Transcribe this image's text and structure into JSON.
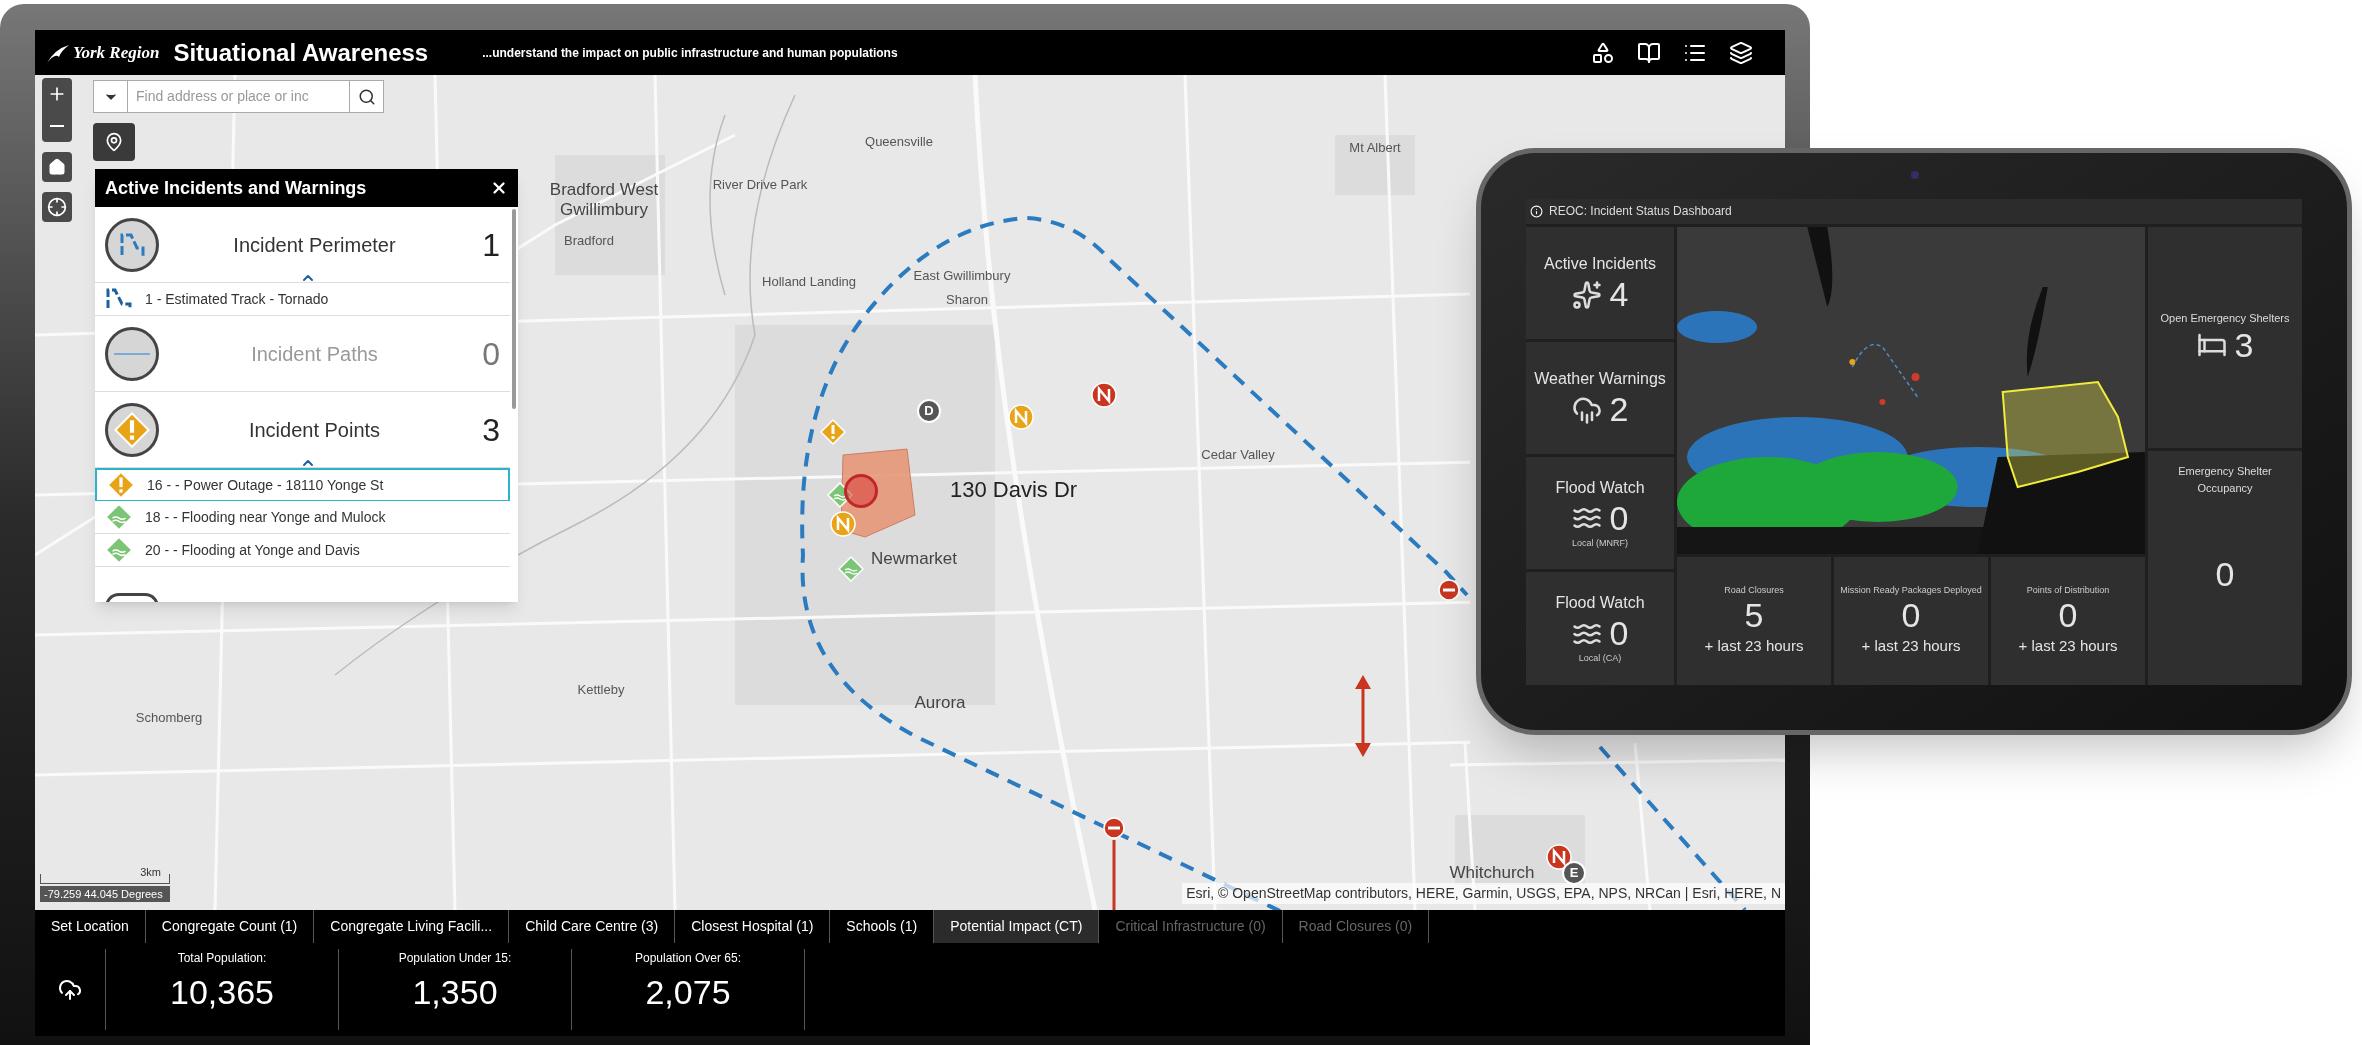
{
  "header": {
    "logo": "York Region",
    "title": "Situational Awareness",
    "tagline": "...understand the impact on public infrastructure and human populations"
  },
  "search": {
    "placeholder": "Find address or place or inc"
  },
  "incident_panel": {
    "title": "Active Incidents and Warnings",
    "groups": [
      {
        "kind": "perimeter",
        "label": "Incident Perimeter",
        "count": "1",
        "disabled": false,
        "items": [
          {
            "kind": "track",
            "label": "1 - Estimated Track - Tornado",
            "selected": false
          }
        ]
      },
      {
        "kind": "path",
        "label": "Incident Paths",
        "count": "0",
        "disabled": true
      },
      {
        "kind": "point",
        "label": "Incident Points",
        "count": "3",
        "disabled": false,
        "items": [
          {
            "kind": "warning",
            "label": "16 - - Power Outage - 18110 Yonge St",
            "selected": true
          },
          {
            "kind": "flood",
            "label": "18 - - Flooding near Yonge and Mulock",
            "selected": false
          },
          {
            "kind": "flood",
            "label": "20 - - Flooding at Yonge and Davis",
            "selected": false
          }
        ]
      }
    ]
  },
  "map_labels": [
    {
      "kind": "small",
      "text": "Queensville"
    },
    {
      "kind": "small",
      "text": "Mt Albert"
    },
    {
      "kind": "town",
      "text": "Bradford West Gwillimbury"
    },
    {
      "kind": "small",
      "text": "Bradford"
    },
    {
      "kind": "small",
      "text": "River Drive Park"
    },
    {
      "kind": "small",
      "text": "Holland Landing"
    },
    {
      "kind": "small",
      "text": "East Gwillimbury"
    },
    {
      "kind": "small",
      "text": "Sharon"
    },
    {
      "kind": "small",
      "text": "Cedar Valley"
    },
    {
      "kind": "address",
      "text": "130 Davis Dr"
    },
    {
      "kind": "town",
      "text": "Newmarket"
    },
    {
      "kind": "small",
      "text": "Kettleby"
    },
    {
      "kind": "small",
      "text": "Schomberg"
    },
    {
      "kind": "town",
      "text": "Aurora"
    },
    {
      "kind": "town",
      "text": "Whitchurch"
    }
  ],
  "map_pins": [
    {
      "kind": "warning"
    },
    {
      "kind": "letter",
      "label": "D"
    },
    {
      "kind": "orange"
    },
    {
      "kind": "red"
    },
    {
      "kind": "flood"
    },
    {
      "kind": "focus"
    },
    {
      "kind": "orange"
    },
    {
      "kind": "flood"
    },
    {
      "kind": "closure"
    },
    {
      "kind": "closure"
    },
    {
      "kind": "red"
    },
    {
      "kind": "letter",
      "label": "E"
    }
  ],
  "scale": {
    "distance": "3km",
    "coordinates": "-79.259 44.045 Degrees"
  },
  "attribution": "Esri, © OpenStreetMap contributors, HERE, Garmin, USGS, EPA, NPS, NRCan | Esri, HERE, N",
  "tabs": [
    {
      "label": "Set Location",
      "selected": false,
      "disabled": false
    },
    {
      "label": "Congregate Count (1)",
      "selected": false,
      "disabled": false
    },
    {
      "label": "Congregate Living Facili...",
      "selected": false,
      "disabled": false
    },
    {
      "label": "Child Care Centre (3)",
      "selected": false,
      "disabled": false
    },
    {
      "label": "Closest Hospital (1)",
      "selected": false,
      "disabled": false
    },
    {
      "label": "Schools (1)",
      "selected": false,
      "disabled": false
    },
    {
      "label": "Potential Impact (CT)",
      "selected": true,
      "disabled": false
    },
    {
      "label": "Critical Infrastructure (0)",
      "selected": false,
      "disabled": true
    },
    {
      "label": "Road Closures (0)",
      "selected": false,
      "disabled": true
    }
  ],
  "stats": [
    {
      "label": "Total Population:",
      "value": "10,365"
    },
    {
      "label": "Population Under 15:",
      "value": "1,350"
    },
    {
      "label": "Population Over 65:",
      "value": "2,075"
    }
  ],
  "tablet": {
    "title": "REOC: Incident Status Dashboard",
    "left_tiles": [
      {
        "kind": "incidents",
        "title": "Active Incidents",
        "value": "4"
      },
      {
        "kind": "weather",
        "title": "Weather Warnings",
        "value": "2"
      },
      {
        "kind": "flood",
        "title": "Flood Watch",
        "value": "0",
        "note": "Local (MNRF)"
      },
      {
        "kind": "flood",
        "title": "Flood Watch",
        "value": "0",
        "note": "Local (CA)"
      }
    ],
    "bottom_tiles": [
      {
        "title": "Road Closures",
        "value": "5",
        "note": "+ last 23 hours"
      },
      {
        "title": "Mission Ready Packages Deployed",
        "value": "0",
        "note": "+ last 23 hours"
      },
      {
        "title": "Points of Distribution",
        "value": "0",
        "note": "+ last 23 hours"
      }
    ],
    "right_tiles": [
      {
        "kind": "shelter",
        "title": "Open Emergency Shelters",
        "value": "3"
      },
      {
        "kind": "plain",
        "title": "Emergency Shelter Occupancy",
        "value": "0"
      }
    ]
  }
}
